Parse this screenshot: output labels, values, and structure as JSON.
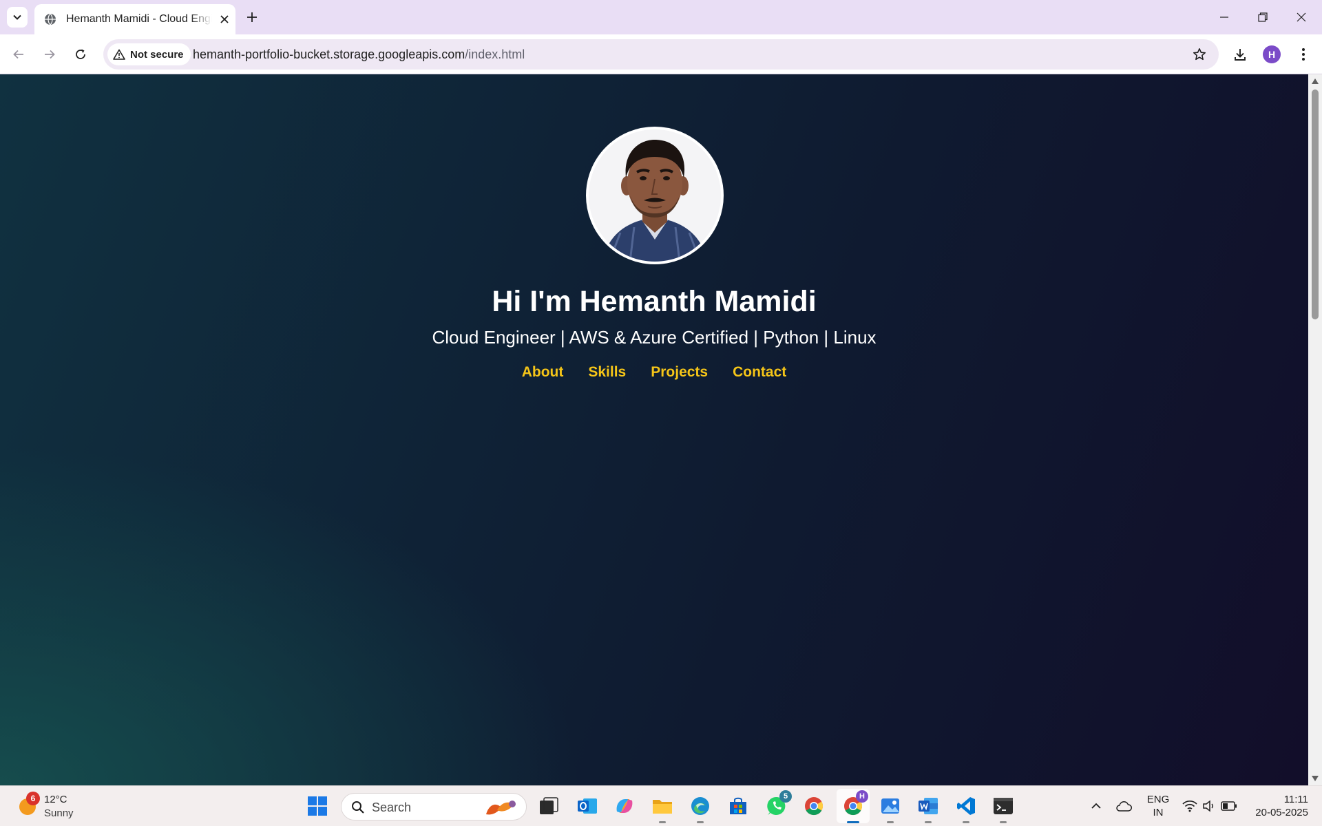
{
  "browser": {
    "tab_title": "Hemanth Mamidi - Cloud Engineer",
    "security_label": "Not secure",
    "url_host": "hemanth-portfolio-bucket.storage.googleapis.com",
    "url_path": "/index.html",
    "profile_initial": "H"
  },
  "page": {
    "name_heading": "Hi I'm Hemanth Mamidi",
    "tagline": "Cloud Engineer | AWS & Azure Certified | Python | Linux",
    "nav": {
      "about": "About",
      "skills": "Skills",
      "projects": "Projects",
      "contact": "Contact"
    },
    "colors": {
      "accent": "#f5c518",
      "text": "#ffffff",
      "bg_dark": "#0f1a30",
      "bg_teal": "#164e4e"
    }
  },
  "taskbar": {
    "weather_badge": "6",
    "weather_temp": "12°C",
    "weather_condition": "Sunny",
    "search_placeholder": "Search",
    "whatsapp_badge": "5",
    "chrome_profile_badge": "H",
    "language_line1": "ENG",
    "language_line2": "IN",
    "time": "11:11",
    "date": "20-05-2025"
  }
}
